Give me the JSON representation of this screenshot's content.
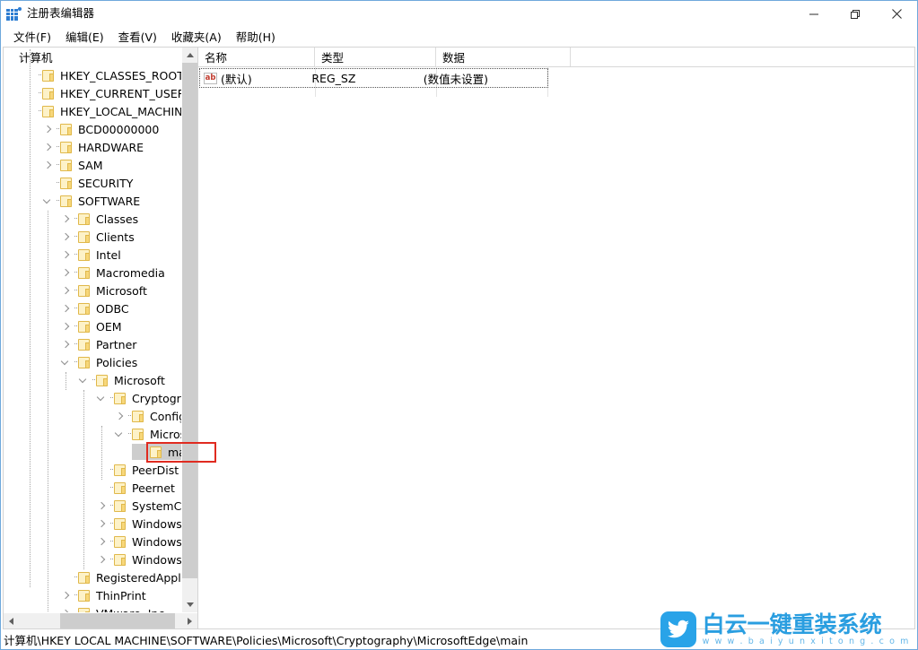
{
  "window": {
    "title": "注册表编辑器",
    "app_icon": "registry-editor-icon",
    "controls": {
      "minimize": "minimize-icon",
      "maximize": "restore-icon",
      "close": "close-icon"
    }
  },
  "menubar": {
    "items": [
      {
        "label": "文件(F)",
        "name": "menu-file"
      },
      {
        "label": "编辑(E)",
        "name": "menu-edit"
      },
      {
        "label": "查看(V)",
        "name": "menu-view"
      },
      {
        "label": "收藏夹(A)",
        "name": "menu-favorites"
      },
      {
        "label": "帮助(H)",
        "name": "menu-help"
      }
    ]
  },
  "tree": {
    "nodes": [
      {
        "label": "计算机",
        "depth": 0,
        "expander": "none",
        "folder": false,
        "selected": false
      },
      {
        "label": "HKEY_CLASSES_ROOT",
        "depth": 1,
        "expander": "none",
        "folder": true,
        "selected": false
      },
      {
        "label": "HKEY_CURRENT_USER",
        "depth": 1,
        "expander": "none",
        "folder": true,
        "selected": false
      },
      {
        "label": "HKEY_LOCAL_MACHINE",
        "depth": 1,
        "expander": "none",
        "folder": true,
        "selected": false
      },
      {
        "label": "BCD00000000",
        "depth": 2,
        "expander": "collapsed",
        "folder": true,
        "selected": false
      },
      {
        "label": "HARDWARE",
        "depth": 2,
        "expander": "collapsed",
        "folder": true,
        "selected": false
      },
      {
        "label": "SAM",
        "depth": 2,
        "expander": "collapsed",
        "folder": true,
        "selected": false
      },
      {
        "label": "SECURITY",
        "depth": 2,
        "expander": "none",
        "folder": true,
        "selected": false
      },
      {
        "label": "SOFTWARE",
        "depth": 2,
        "expander": "expanded",
        "folder": true,
        "selected": false
      },
      {
        "label": "Classes",
        "depth": 3,
        "expander": "collapsed",
        "folder": true,
        "selected": false
      },
      {
        "label": "Clients",
        "depth": 3,
        "expander": "collapsed",
        "folder": true,
        "selected": false
      },
      {
        "label": "Intel",
        "depth": 3,
        "expander": "collapsed",
        "folder": true,
        "selected": false
      },
      {
        "label": "Macromedia",
        "depth": 3,
        "expander": "collapsed",
        "folder": true,
        "selected": false
      },
      {
        "label": "Microsoft",
        "depth": 3,
        "expander": "collapsed",
        "folder": true,
        "selected": false
      },
      {
        "label": "ODBC",
        "depth": 3,
        "expander": "collapsed",
        "folder": true,
        "selected": false
      },
      {
        "label": "OEM",
        "depth": 3,
        "expander": "collapsed",
        "folder": true,
        "selected": false
      },
      {
        "label": "Partner",
        "depth": 3,
        "expander": "collapsed",
        "folder": true,
        "selected": false
      },
      {
        "label": "Policies",
        "depth": 3,
        "expander": "expanded",
        "folder": true,
        "selected": false
      },
      {
        "label": "Microsoft",
        "depth": 4,
        "expander": "expanded",
        "folder": true,
        "selected": false
      },
      {
        "label": "Cryptography",
        "depth": 5,
        "expander": "expanded",
        "folder": true,
        "selected": false
      },
      {
        "label": "Configuration",
        "depth": 6,
        "expander": "collapsed",
        "folder": true,
        "selected": false
      },
      {
        "label": "MicrosoftEdge",
        "depth": 6,
        "expander": "expanded",
        "folder": true,
        "selected": false
      },
      {
        "label": "main",
        "depth": 7,
        "expander": "none",
        "folder": true,
        "selected": true
      },
      {
        "label": "PeerDist",
        "depth": 5,
        "expander": "none",
        "folder": true,
        "selected": false
      },
      {
        "label": "Peernet",
        "depth": 5,
        "expander": "none",
        "folder": true,
        "selected": false
      },
      {
        "label": "SystemCertificates",
        "depth": 5,
        "expander": "collapsed",
        "folder": true,
        "selected": false
      },
      {
        "label": "Windows",
        "depth": 5,
        "expander": "collapsed",
        "folder": true,
        "selected": false
      },
      {
        "label": "Windows Defender",
        "depth": 5,
        "expander": "collapsed",
        "folder": true,
        "selected": false
      },
      {
        "label": "Windows NT",
        "depth": 5,
        "expander": "collapsed",
        "folder": true,
        "selected": false
      },
      {
        "label": "RegisteredApplications",
        "depth": 3,
        "expander": "none",
        "folder": true,
        "selected": false
      },
      {
        "label": "ThinPrint",
        "depth": 3,
        "expander": "collapsed",
        "folder": true,
        "selected": false
      },
      {
        "label": "VMware, Inc.",
        "depth": 3,
        "expander": "collapsed",
        "folder": true,
        "selected": false
      }
    ]
  },
  "list": {
    "columns": [
      {
        "label": "名称",
        "name": "column-name"
      },
      {
        "label": "类型",
        "name": "column-type"
      },
      {
        "label": "数据",
        "name": "column-data"
      }
    ],
    "rows": [
      {
        "icon": "string-value-icon",
        "icon_text": "ab",
        "name": "(默认)",
        "type": "REG_SZ",
        "data": "(数值未设置)"
      }
    ]
  },
  "statusbar": {
    "path": "计算机\\HKEY LOCAL MACHINE\\SOFTWARE\\Policies\\Microsoft\\Cryptography\\MicrosoftEdge\\main"
  },
  "watermark": {
    "title": "白云一键重装系统",
    "url": "w w w . b a i y u n x i t o n g . c o m",
    "logo": "bird-logo"
  },
  "colors": {
    "accent": "#2a9ee0",
    "annotation": "#e02b20",
    "selection": "#cdcdcd",
    "folder": "#f7d77a",
    "window_border": "#6fa8dc"
  }
}
